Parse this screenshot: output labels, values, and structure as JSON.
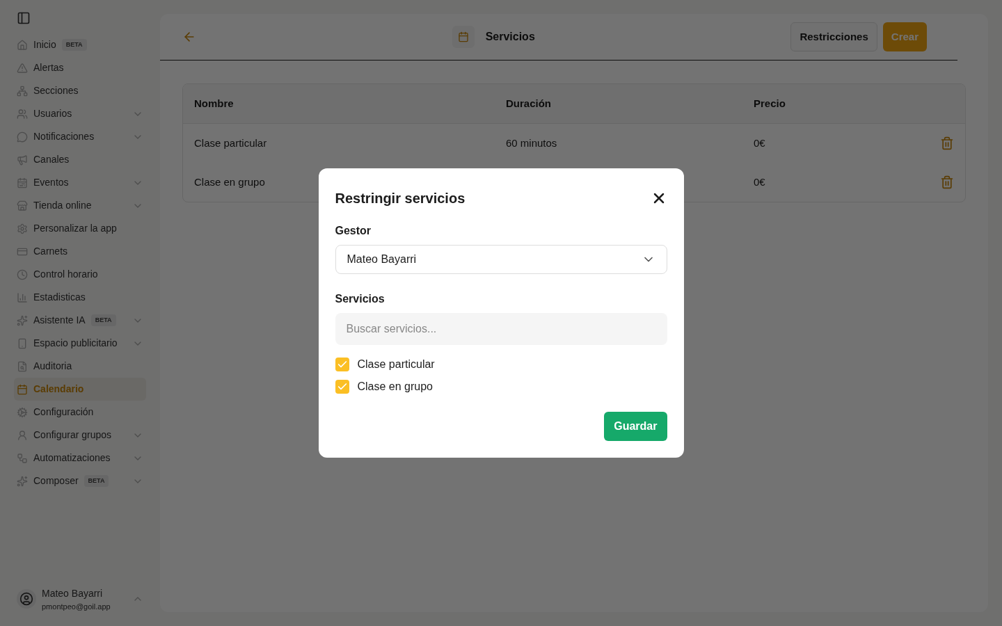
{
  "sidebar": {
    "items": [
      {
        "label": "Inicio",
        "badge": "BETA",
        "expandable": false,
        "selected": false
      },
      {
        "label": "Alertas",
        "expandable": false,
        "selected": false
      },
      {
        "label": "Secciones",
        "expandable": false,
        "selected": false
      },
      {
        "label": "Usuarios",
        "expandable": true,
        "selected": false
      },
      {
        "label": "Notificaciones",
        "expandable": true,
        "selected": false
      },
      {
        "label": "Canales",
        "expandable": false,
        "selected": false
      },
      {
        "label": "Eventos",
        "expandable": true,
        "selected": false
      },
      {
        "label": "Tienda online",
        "expandable": true,
        "selected": false
      },
      {
        "label": "Personalizar la app",
        "expandable": false,
        "selected": false
      },
      {
        "label": "Carnets",
        "expandable": false,
        "selected": false
      },
      {
        "label": "Control horario",
        "expandable": false,
        "selected": false
      },
      {
        "label": "Estadisticas",
        "expandable": false,
        "selected": false
      },
      {
        "label": "Asistente IA",
        "badge": "BETA",
        "expandable": true,
        "selected": false
      },
      {
        "label": "Espacio publicitario",
        "expandable": true,
        "selected": false
      },
      {
        "label": "Auditoria",
        "expandable": false,
        "selected": false
      },
      {
        "label": "Calendario",
        "expandable": false,
        "selected": true
      },
      {
        "label": "Configuración",
        "expandable": false,
        "selected": false
      },
      {
        "label": "Configurar grupos",
        "expandable": true,
        "selected": false
      },
      {
        "label": "Automatizaciones",
        "expandable": true,
        "selected": false
      },
      {
        "label": "Composer",
        "badge": "BETA",
        "expandable": true,
        "selected": false
      }
    ],
    "user": {
      "name": "Mateo Bayarri",
      "email": "pmontpeo@goil.app"
    }
  },
  "header": {
    "title": "Servicios",
    "buttons": [
      "Restricciones",
      "Crear"
    ]
  },
  "table": {
    "columns": [
      "Nombre",
      "Duración",
      "Precio"
    ],
    "rows": [
      {
        "cells": [
          "Clase particular",
          "60 minutos",
          "0€"
        ]
      },
      {
        "cells": [
          "Clase en grupo",
          "",
          "0€"
        ]
      }
    ]
  },
  "dialog": {
    "title": "Restringir servicios",
    "gestor_label": "Gestor",
    "gestor_value": "Mateo Bayarri",
    "servicios_label": "Servicios",
    "search_placeholder": "Buscar servicios...",
    "options": [
      {
        "label": "Clase particular",
        "checked": true
      },
      {
        "label": "Clase en grupo",
        "checked": true
      }
    ],
    "save": "Guardar"
  }
}
